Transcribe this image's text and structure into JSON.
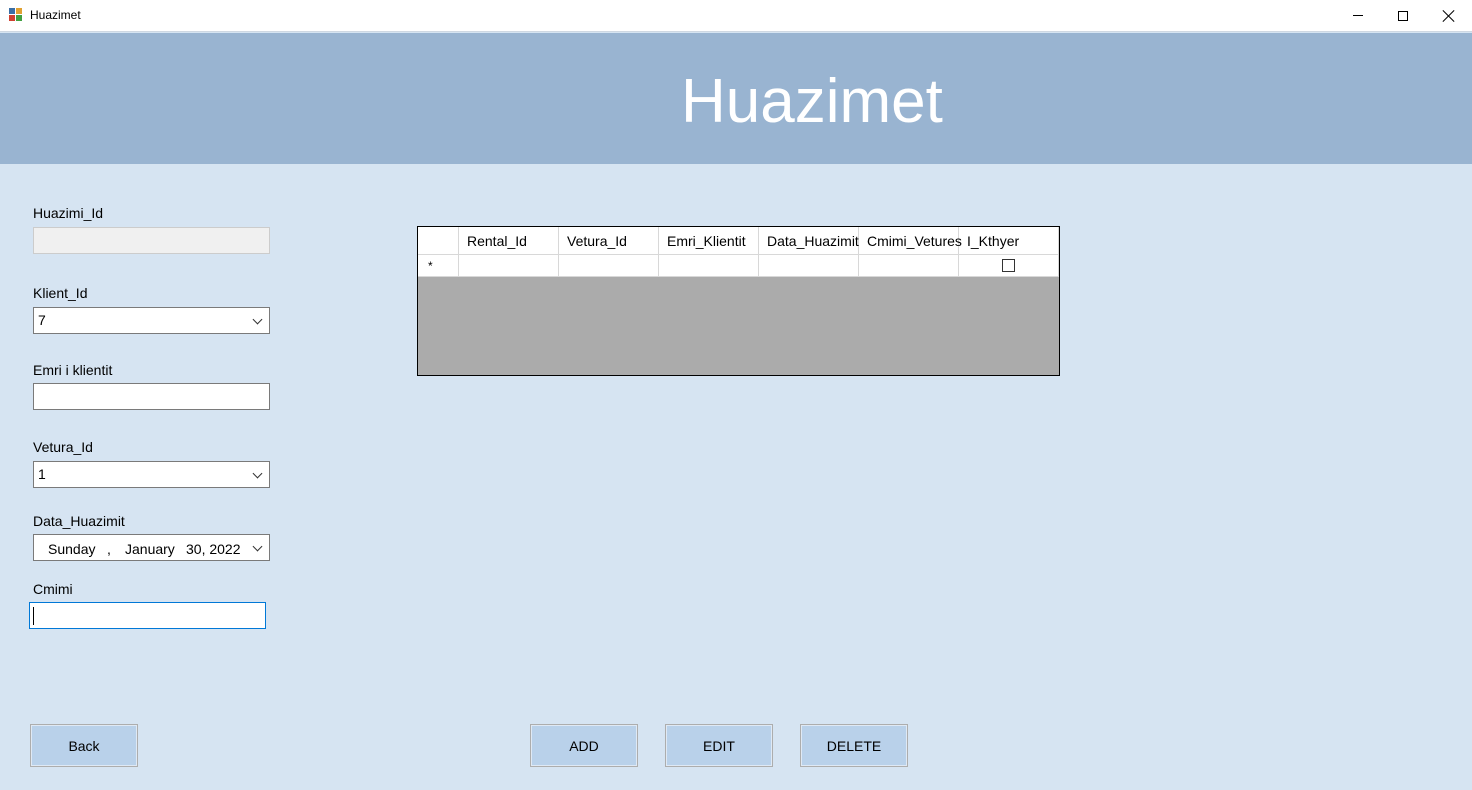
{
  "window": {
    "title": "Huazimet"
  },
  "header": {
    "title": "Huazimet"
  },
  "form": {
    "huazimi_id": {
      "label": "Huazimi_Id",
      "value": ""
    },
    "klient_id": {
      "label": "Klient_Id",
      "value": "7"
    },
    "emri_klientit": {
      "label": "Emri i klientit",
      "value": ""
    },
    "vetura_id": {
      "label": "Vetura_Id",
      "value": "1"
    },
    "data_huazimit": {
      "label": "Data_Huazimit",
      "weekday": "Sunday",
      "separator": ",",
      "month": "January",
      "day_year": "30, 2022"
    },
    "cmimi": {
      "label": "Cmimi",
      "value": ""
    }
  },
  "grid": {
    "columns": [
      "Rental_Id",
      "Vetura_Id",
      "Emri_Klientit",
      "Data_Huazimit",
      "Cmimi_Vetures",
      "I_Kthyer"
    ],
    "new_row_marker": "*",
    "new_row": {
      "i_kthyer_checked": false
    }
  },
  "buttons": {
    "back": "Back",
    "add": "ADD",
    "edit": "EDIT",
    "delete": "DELETE"
  },
  "colors": {
    "background": "#d6e4f2",
    "header": "#99b4d1",
    "button": "#b9d1ea",
    "grid_empty": "#ababab"
  },
  "icons": {
    "app": "app-icon",
    "minimize": "minimize-icon",
    "maximize": "maximize-icon",
    "close": "close-icon",
    "dropdown": "chevron-down-icon"
  }
}
